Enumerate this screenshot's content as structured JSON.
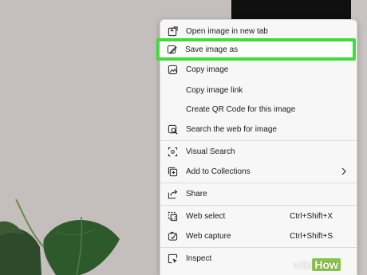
{
  "menu": {
    "items": [
      {
        "label": "Open image in new tab",
        "icon": "new-tab-icon"
      },
      {
        "label": "Save image as",
        "icon": "save-image-icon",
        "highlighted": true
      },
      {
        "label": "Copy image",
        "icon": "copy-image-icon"
      },
      {
        "label": "Copy image link",
        "icon": ""
      },
      {
        "label": "Create QR Code for this image",
        "icon": ""
      },
      {
        "label": "Search the web for image",
        "icon": "image-search-icon"
      },
      {
        "label": "Visual Search",
        "icon": "visual-search-icon"
      },
      {
        "label": "Add to Collections",
        "icon": "collections-icon",
        "submenu": true
      },
      {
        "label": "Share",
        "icon": "share-icon"
      },
      {
        "label": "Web select",
        "icon": "web-select-icon",
        "shortcut": "Ctrl+Shift+X"
      },
      {
        "label": "Web capture",
        "icon": "web-capture-icon",
        "shortcut": "Ctrl+Shift+S"
      },
      {
        "label": "Inspect",
        "icon": "inspect-icon"
      }
    ]
  },
  "watermark": {
    "part1": "wiki",
    "part2": "How"
  },
  "colors": {
    "highlight": "#3ddd3a",
    "menu_bg": "#f7f7f7",
    "wall": "#c4bfbd",
    "dark_panel": "#0f0f0f"
  }
}
